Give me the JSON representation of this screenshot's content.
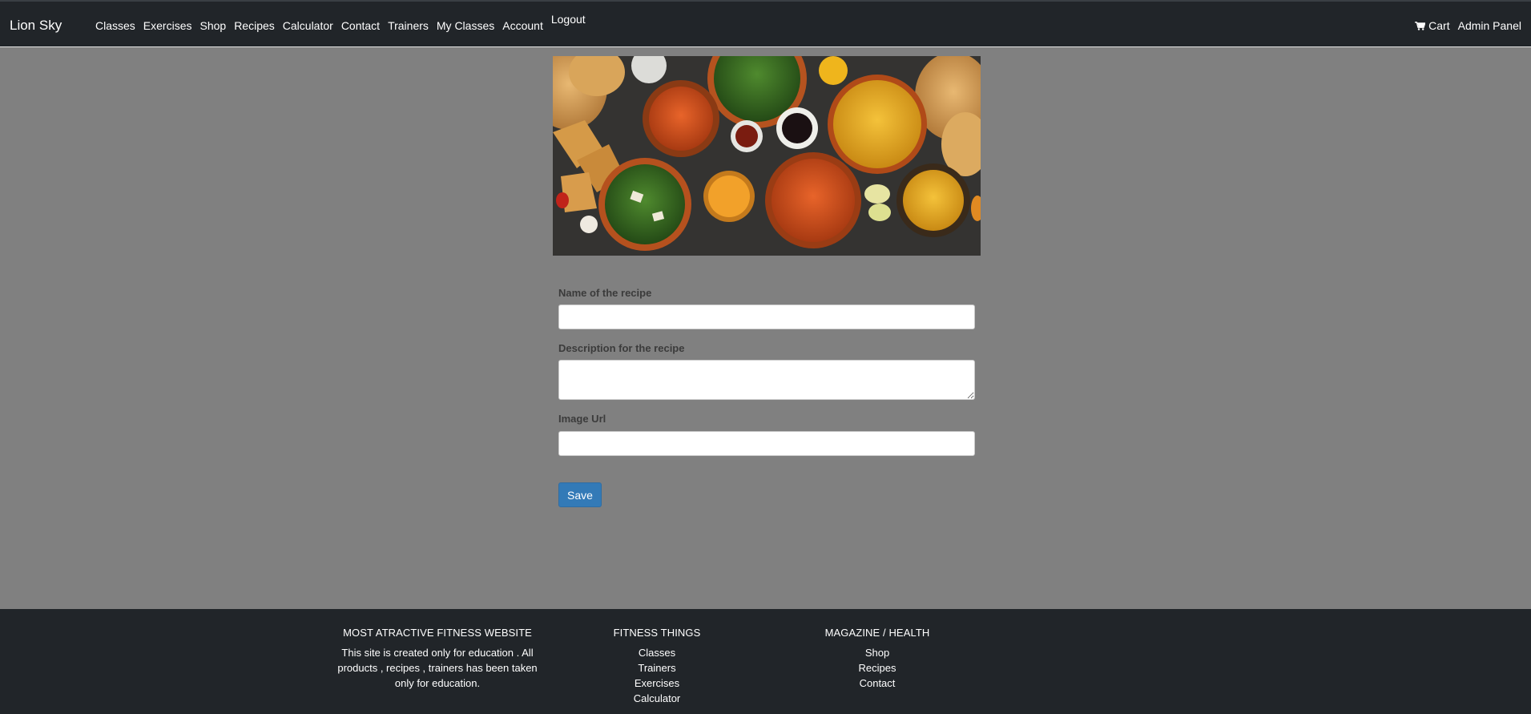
{
  "nav": {
    "brand": "Lion Sky",
    "links": [
      "Classes",
      "Exercises",
      "Shop",
      "Recipes",
      "Calculator",
      "Contact",
      "Trainers",
      "My Classes",
      "Account"
    ],
    "logout": "Logout",
    "cart": "Cart",
    "admin": "Admin Panel"
  },
  "form": {
    "name_label": "Name of the recipe",
    "name_value": "",
    "description_label": "Description for the recipe",
    "description_value": "",
    "image_label": "Image Url",
    "image_value": "",
    "save_label": "Save"
  },
  "footer": {
    "col1": {
      "title": "MOST ATRACTIVE FITNESS WEBSITE",
      "text": "This site is created only for education . All products , recipes , trainers has been taken only for education."
    },
    "col2": {
      "title": "FITNESS THINGS",
      "links": [
        "Classes",
        "Trainers",
        "Exercises",
        "Calculator"
      ]
    },
    "col3": {
      "title": "MAGAZINE / HEALTH",
      "links": [
        "Shop",
        "Recipes",
        "Contact"
      ]
    }
  },
  "colors": {
    "navbar": "#212529",
    "page_bg": "#808080",
    "button": "#337ab7"
  },
  "icons": {
    "cart": "shopping-cart-icon"
  }
}
